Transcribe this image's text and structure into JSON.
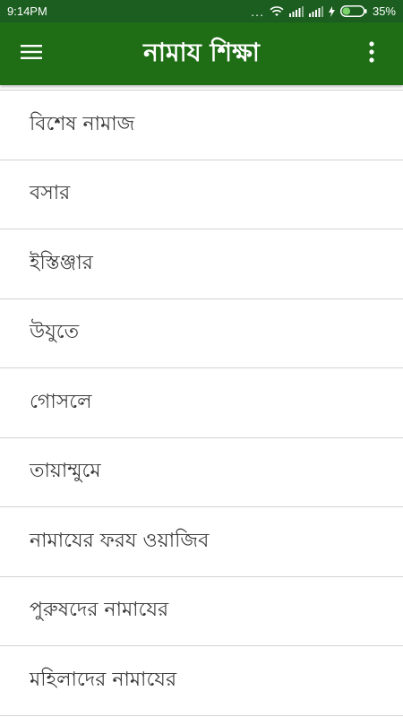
{
  "status_bar": {
    "time": "9:14PM",
    "dots": "...",
    "battery_percent": "35%"
  },
  "app_bar": {
    "title": "নামায শিক্ষা",
    "menu_icon": "hamburger-menu-icon",
    "overflow_icon": "more-vert-icon"
  },
  "colors": {
    "status_bar": "#1b5e20",
    "app_bar": "#1f6e16",
    "text": "#3a3a3a",
    "divider": "#d3d3d3"
  },
  "list": {
    "items": [
      {
        "label": "বিশেষ নামাজ"
      },
      {
        "label": "বসার"
      },
      {
        "label": "ইস্তিঞ্জার"
      },
      {
        "label": "উযুতে"
      },
      {
        "label": "গোসলে"
      },
      {
        "label": "তায়াম্মুমে"
      },
      {
        "label": "নামাযের  ফরয ওয়াজিব"
      },
      {
        "label": "পুরুষদের নামাযের"
      },
      {
        "label": "মহিলাদের নামাযের"
      }
    ]
  }
}
